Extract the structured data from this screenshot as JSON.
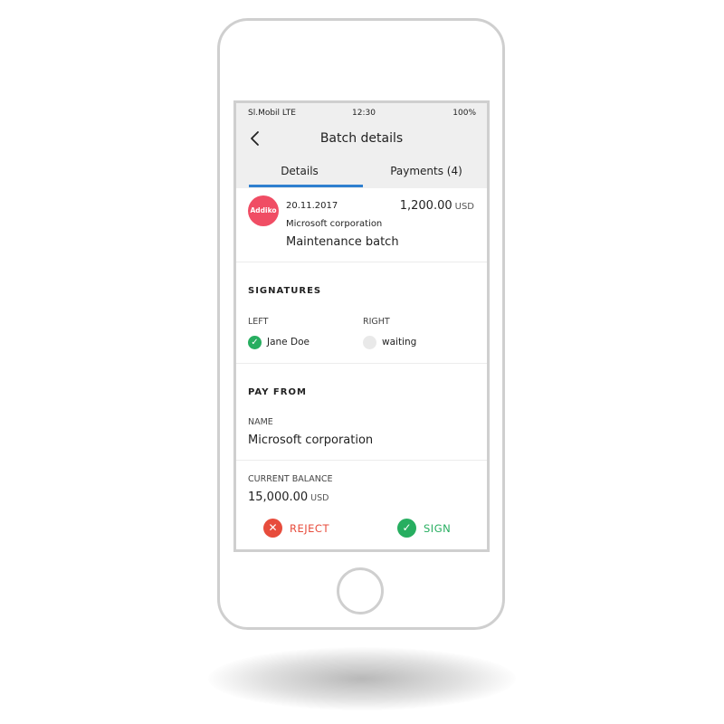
{
  "status_bar": {
    "carrier": "Sl.Mobil LTE",
    "time": "12:30",
    "battery": "100%"
  },
  "header": {
    "title": "Batch details",
    "back_icon": "chevron-left-icon"
  },
  "tabs": [
    {
      "label": "Details",
      "active": true
    },
    {
      "label": "Payments (4)",
      "active": false
    }
  ],
  "accent_color": "#2f7fcf",
  "batch": {
    "logo_text": "Addiko",
    "logo_color": "#f04d64",
    "date": "20.11.2017",
    "amount": "1,200.00",
    "currency": "USD",
    "company": "Microsoft corporation",
    "name": "Maintenance batch"
  },
  "signatures": {
    "title": "SIGNATURES",
    "left": {
      "label": "LEFT",
      "name": "Jane Doe",
      "status": "signed"
    },
    "right": {
      "label": "RIGHT",
      "name": "waiting",
      "status": "waiting"
    }
  },
  "pay_from": {
    "title": "PAY FROM",
    "name_label": "NAME",
    "name_value": "Microsoft corporation",
    "balance_label": "CURRENT BALANCE",
    "balance_value": "15,000.00",
    "balance_currency": "USD"
  },
  "actions": {
    "reject_label": "REJECT",
    "reject_color": "#e74c3c",
    "sign_label": "SIGN",
    "sign_color": "#27ae60"
  }
}
